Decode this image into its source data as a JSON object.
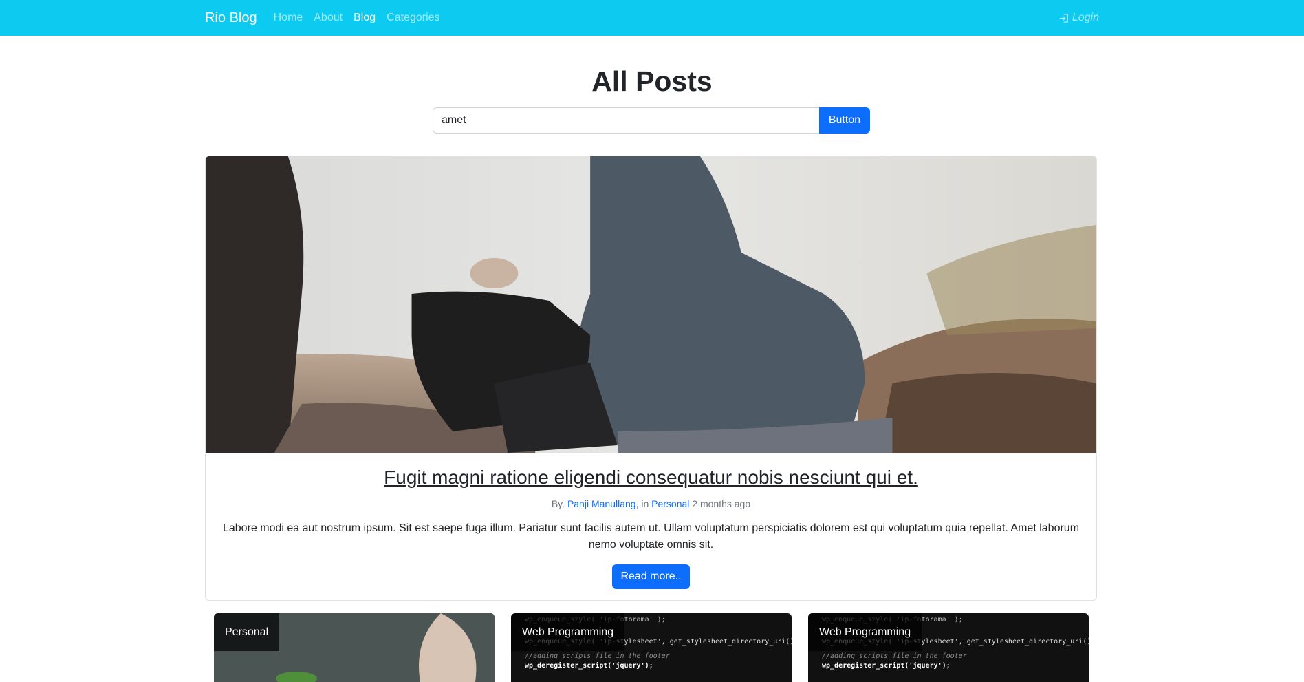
{
  "navbar": {
    "brand": "Rio Blog",
    "links": [
      {
        "label": "Home",
        "active": false
      },
      {
        "label": "About",
        "active": false
      },
      {
        "label": "Blog",
        "active": true
      },
      {
        "label": "Categories",
        "active": false
      }
    ],
    "login_label": "Login",
    "colors": {
      "background": "#0dcaf0"
    }
  },
  "page": {
    "title": "All Posts"
  },
  "search": {
    "value": "amet",
    "button_label": "Button"
  },
  "featured_post": {
    "title": "Fugit magni ratione eligendi consequatur nobis nesciunt qui et.",
    "meta_by": "By.",
    "author": "Panji Manullang",
    "meta_in": ", in",
    "category": "Personal",
    "time_ago": "2 months ago",
    "excerpt": "Labore modi ea aut nostrum ipsum. Sit est saepe fuga illum. Pariatur sunt facilis autem ut. Ullam voluptatum perspiciatis dolorem est qui voluptatum quia repellat. Amet laborum nemo voluptate omnis sit.",
    "read_more_label": "Read more.."
  },
  "post_cards": [
    {
      "category": "Personal"
    },
    {
      "category": "Web Programming"
    },
    {
      "category": "Web Programming"
    }
  ],
  "code_snippet": {
    "line1": "wp_enqueue_style( 'ip-fotorama' );",
    "line2": "wp_enqueue_style( 'ip-stylesheet', get_stylesheet_directory_uri()",
    "line3": "//adding scripts file in the footer",
    "line4": "wp_deregister_script('jquery');"
  },
  "colors": {
    "primary": "#0d6efd",
    "text": "#212529",
    "muted": "#6c757d"
  }
}
